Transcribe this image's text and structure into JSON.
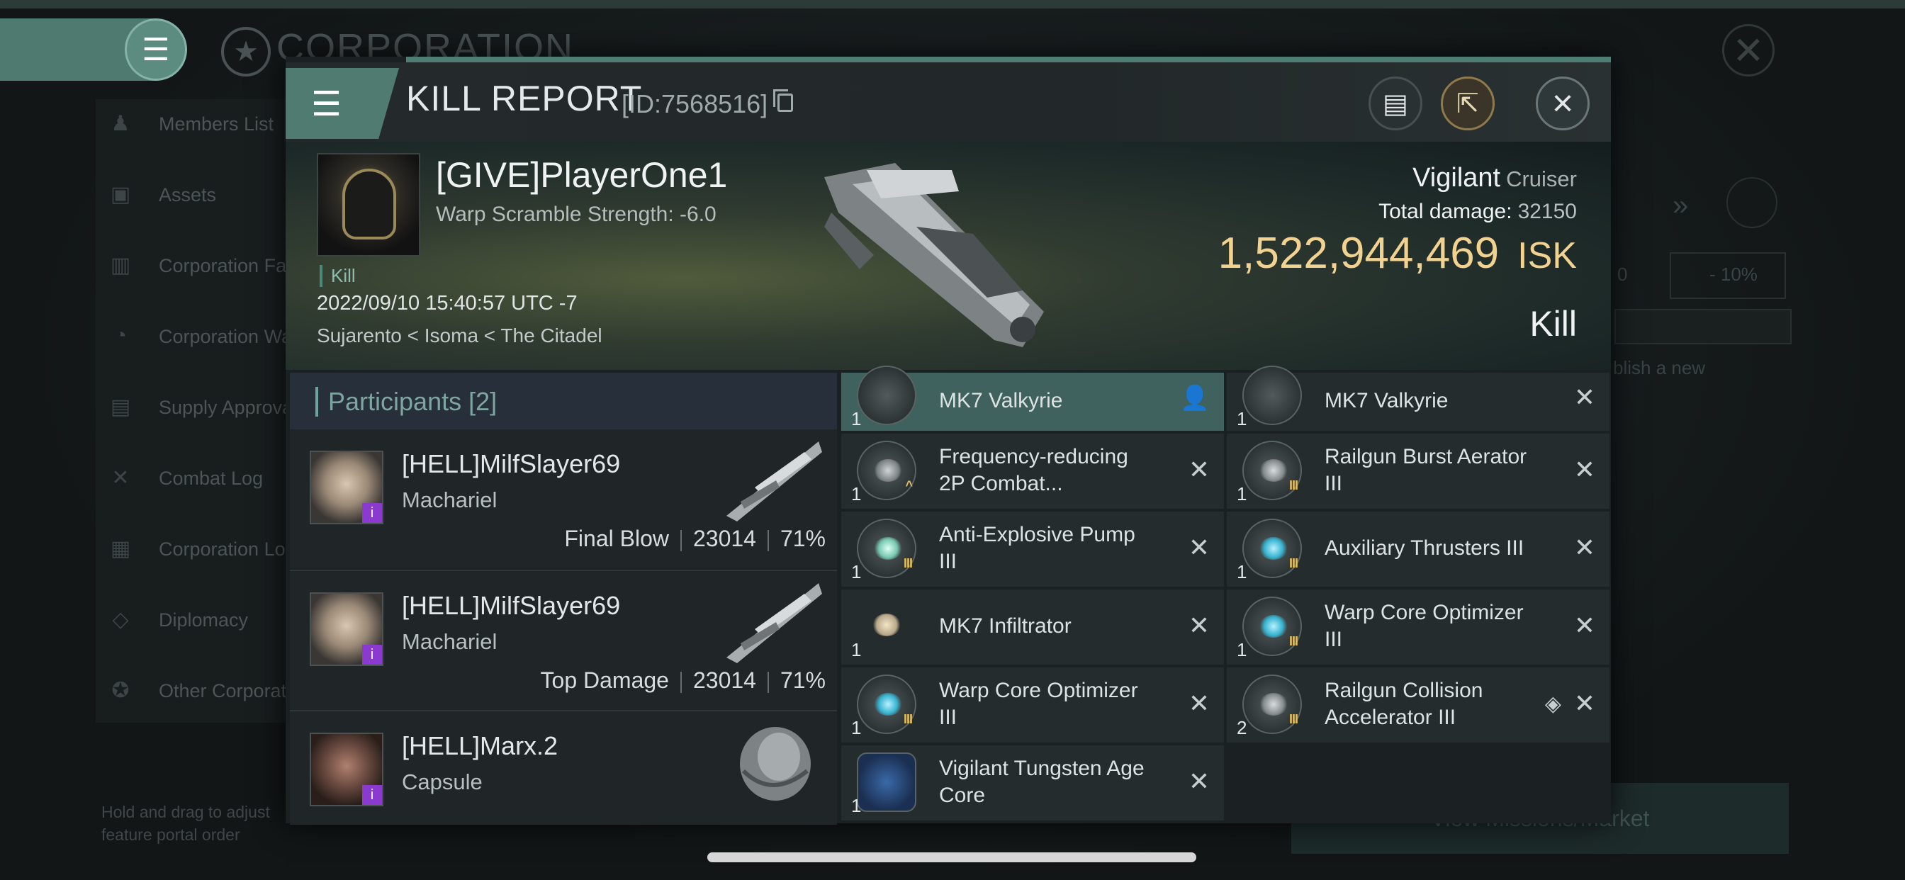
{
  "background": {
    "title": "CORPORATION",
    "sidebar": [
      {
        "label": "Members List",
        "icon": "members-icon"
      },
      {
        "label": "Assets",
        "icon": "assets-icon"
      },
      {
        "label": "Corporation Fa",
        "icon": "facilities-icon"
      },
      {
        "label": "Corporation Wa",
        "icon": "wallet-icon"
      },
      {
        "label": "Supply Approva",
        "icon": "supply-icon"
      },
      {
        "label": "Combat Log",
        "icon": "combat-icon"
      },
      {
        "label": "Corporation Lo",
        "icon": "log-icon"
      },
      {
        "label": "Diplomacy",
        "icon": "diplomacy-icon"
      },
      {
        "label": "Other Corporat",
        "icon": "other-corp-icon"
      }
    ],
    "hint": "Hold and drag to adjust feature portal order",
    "right_button": "View Missions/Market",
    "right_texts": {
      "zero": "0",
      "percent": "- 10%",
      "publish": "blish a new"
    }
  },
  "header": {
    "title": "KILL REPORT",
    "id_text": "[ID:7568516]"
  },
  "victim": {
    "pilot": "[GIVE]PlayerOne1",
    "scram": "Warp Scramble Strength: -6.0",
    "tag": "Kill",
    "datetime": "2022/09/10 15:40:57 UTC -7",
    "location": "Sujarento < Isoma < The Citadel",
    "ship_name": "Vigilant",
    "ship_class": "Cruiser",
    "total_damage_label": "Total damage:",
    "total_damage": "32150",
    "isk_value": "1,522,944,469",
    "isk_unit": "ISK",
    "result": "Kill"
  },
  "participants": {
    "label": "Participants",
    "count": "[2]",
    "rows": [
      {
        "name": "[HELL]MilfSlayer69",
        "ship": "Machariel",
        "role": "Final Blow",
        "damage": "23014",
        "pct": "71%"
      },
      {
        "name": "[HELL]MilfSlayer69",
        "ship": "Machariel",
        "role": "Top Damage",
        "damage": "23014",
        "pct": "71%"
      },
      {
        "name": "[HELL]Marx.2",
        "ship": "Capsule",
        "role": "",
        "damage": "",
        "pct": ""
      }
    ]
  },
  "modules_left": [
    {
      "name": "MK7  Valkyrie",
      "qty": "1"
    },
    {
      "name": "Frequency-reducing 2P Combat...",
      "qty": "1"
    },
    {
      "name": "Anti-Explosive Pump III",
      "qty": "1"
    },
    {
      "name": "MK7  Infiltrator",
      "qty": "1"
    },
    {
      "name": "Warp Core Optimizer III",
      "qty": "1"
    },
    {
      "name": "Vigilant Tungsten Age Core",
      "qty": "1"
    }
  ],
  "modules_right": [
    {
      "name": "MK7  Valkyrie",
      "qty": "1"
    },
    {
      "name": "Railgun Burst Aerator III",
      "qty": "1"
    },
    {
      "name": "Auxiliary Thrusters III",
      "qty": "1"
    },
    {
      "name": "Warp Core Optimizer III",
      "qty": "1"
    },
    {
      "name": "Railgun Collision Accelerator III",
      "qty": "2"
    }
  ],
  "colors": {
    "accent": "#4f7b71",
    "isk": "#f2d290",
    "highlight": "#3f625f",
    "badge": "#8b3ad0"
  }
}
